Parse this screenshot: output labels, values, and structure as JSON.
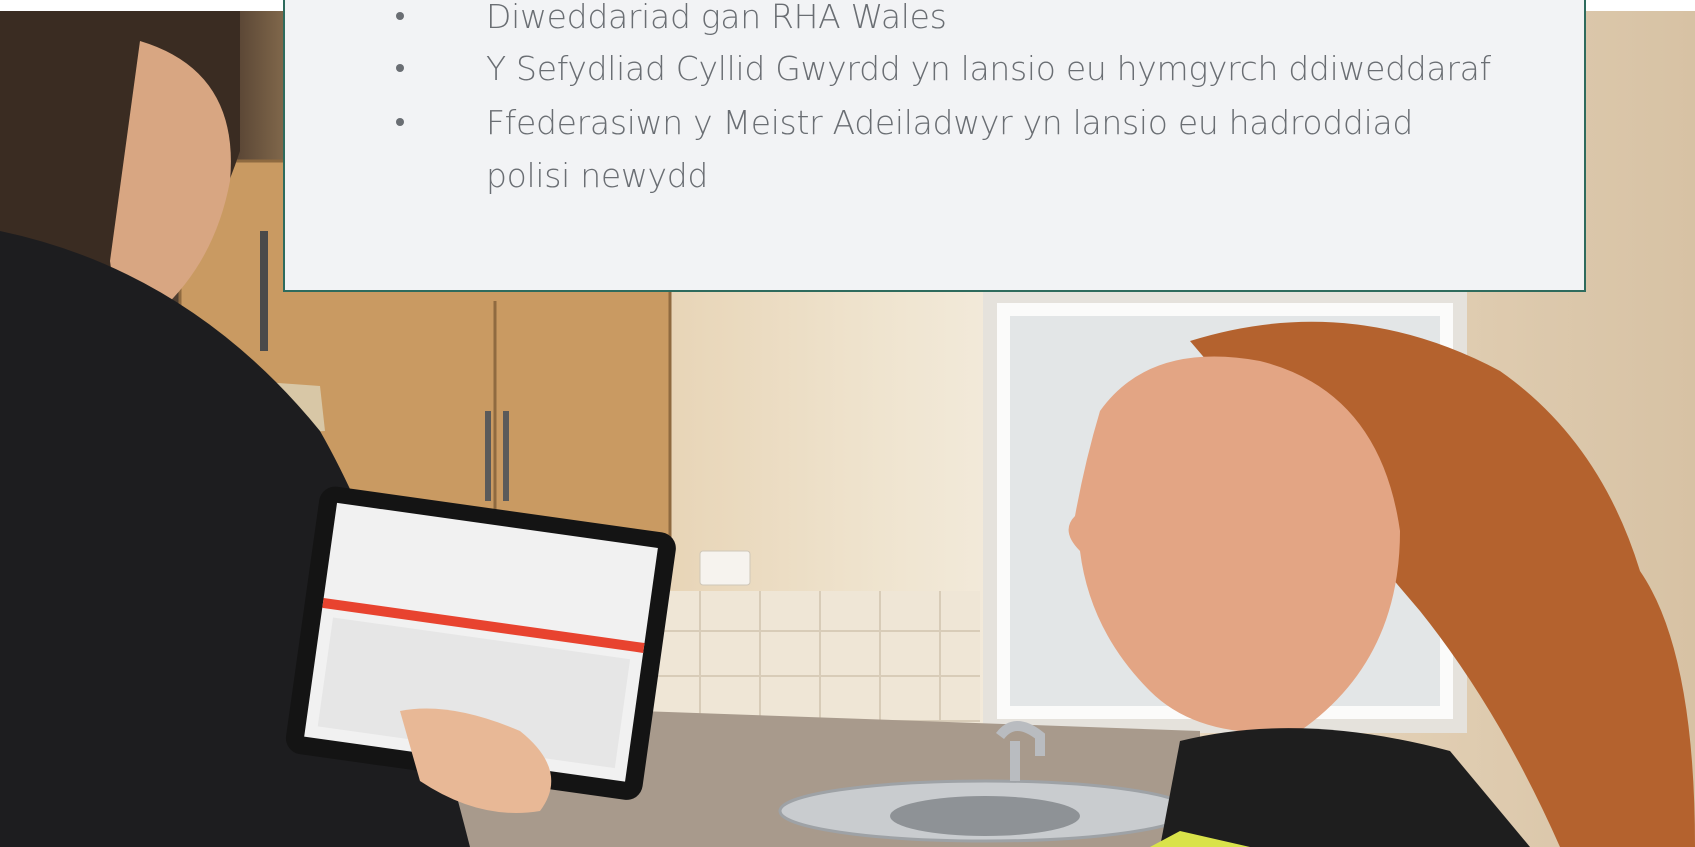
{
  "news_panel": {
    "items": [
      {
        "text": "Diweddariad gan RHA Wales"
      },
      {
        "text": "Y Sefydliad Cyllid Gwyrdd yn lansio eu hymgyrch ddiweddaraf"
      },
      {
        "text": "Ffederasiwn y Meistr Adeiladwyr yn lansio eu hadroddiad polisi newydd"
      }
    ],
    "border_color": "#2e6b5d",
    "background": "#f2f3f5",
    "text_color": "#6a6e73"
  },
  "photo": {
    "subject": "kitchen-inspection-tablet-photo"
  }
}
